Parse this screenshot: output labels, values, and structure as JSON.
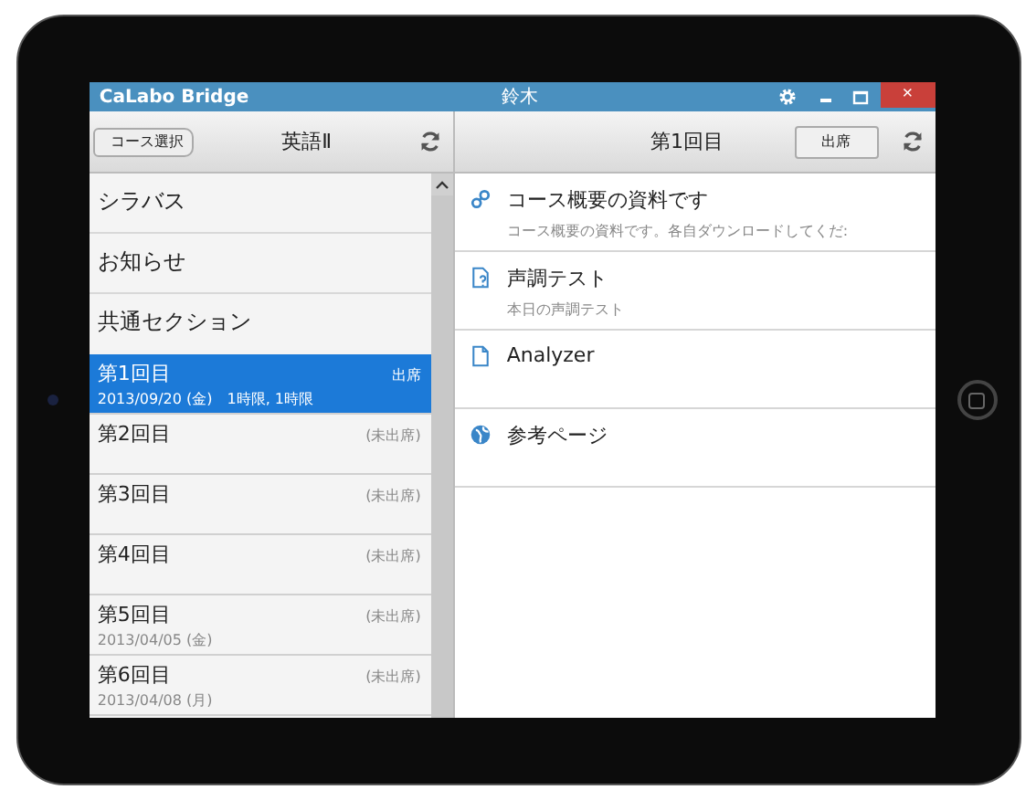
{
  "window": {
    "title": "CaLabo Bridge",
    "user": "鈴木",
    "close_glyph": "×"
  },
  "left_header": {
    "back_button": "コース選択",
    "title": "英語Ⅱ"
  },
  "menu_items": [
    {
      "label": "シラバス"
    },
    {
      "label": "お知らせ"
    },
    {
      "label": "共通セクション"
    }
  ],
  "sessions": [
    {
      "title": "第1回目",
      "date": "2013/09/20 (金)　1時限, 1時限",
      "status": "出席",
      "selected": true
    },
    {
      "title": "第2回目",
      "status": "(未出席)",
      "selected": false
    },
    {
      "title": "第3回目",
      "status": "(未出席)",
      "selected": false
    },
    {
      "title": "第4回目",
      "status": "(未出席)",
      "selected": false
    },
    {
      "title": "第5回目",
      "date": "2013/04/05 (金)",
      "status": "(未出席)",
      "selected": false
    },
    {
      "title": "第6回目",
      "date": "2013/04/08 (月)",
      "status": "(未出席)",
      "selected": false
    }
  ],
  "right_header": {
    "title": "第1回目",
    "button": "出席"
  },
  "resources": [
    {
      "kind": "link",
      "title": "コース概要の資料です",
      "subtitle": "コース概要の資料です。各自ダウンロードしてくだ:"
    },
    {
      "kind": "test",
      "title": "声調テスト",
      "subtitle": "本日の声調テスト"
    },
    {
      "kind": "document",
      "title": "Analyzer"
    },
    {
      "kind": "web",
      "title": "参考ページ"
    }
  ]
}
